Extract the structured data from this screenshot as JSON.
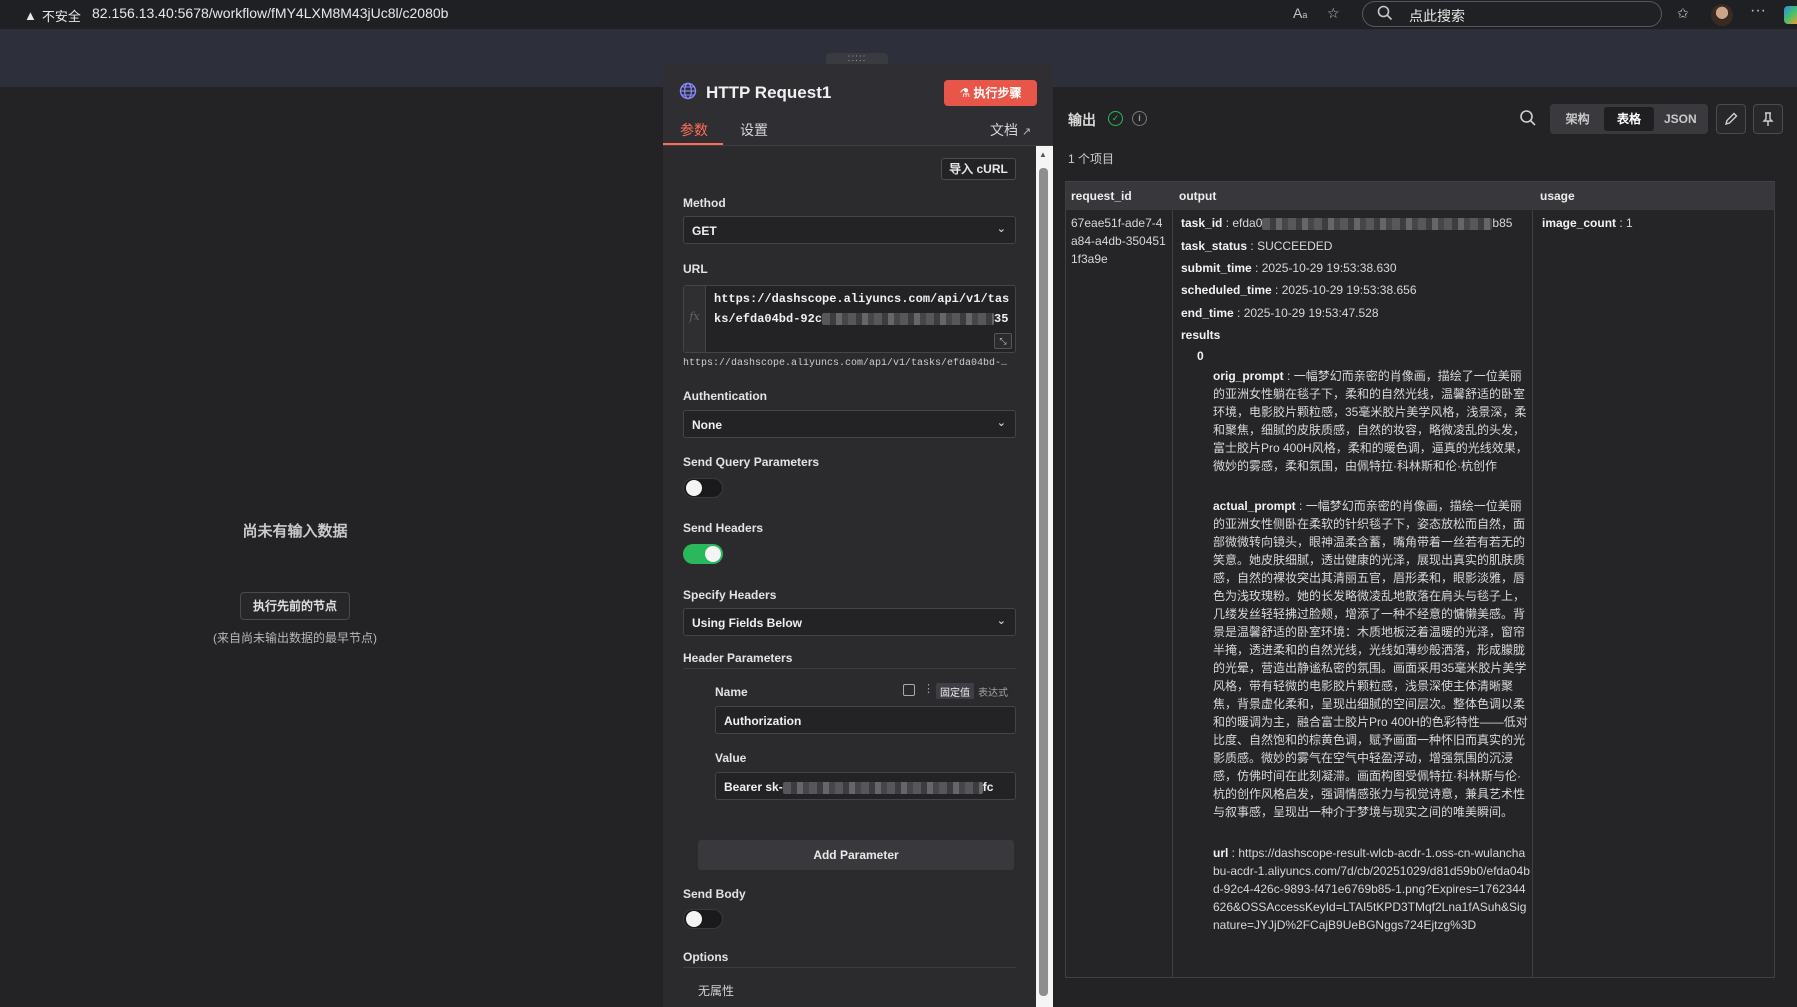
{
  "browser": {
    "security_label": "不安全",
    "url": "82.156.13.40:5678/workflow/fMY4LXM8M43jUc8l/c2080b",
    "search_placeholder": "点此搜索"
  },
  "input_panel": {
    "empty_title": "尚未有输入数据",
    "run_previous_label": "执行先前的节点",
    "run_previous_hint": "(来自尚未输出数据的最早节点)"
  },
  "node": {
    "drag_label": ":::::",
    "title": "HTTP Request1",
    "execute_step_label": "执行步骤",
    "tabs": [
      "参数",
      "设置"
    ],
    "docs_label": "文档",
    "import_curl_label": "导入 cURL",
    "method": {
      "label": "Method",
      "value": "GET"
    },
    "url": {
      "label": "URL",
      "value_line1": "https://dashscope.aliyuncs.com/api/v1/tas",
      "value_line2_start": "ks/efda04bd-92c",
      "value_line2_end": "35",
      "fx_label": "fx",
      "preview": "https://dashscope.aliyuncs.com/api/v1/tasks/efda04bd-…"
    },
    "authentication": {
      "label": "Authentication",
      "value": "None"
    },
    "send_query_parameters": {
      "label": "Send Query Parameters",
      "on": false
    },
    "send_headers": {
      "label": "Send Headers",
      "on": true
    },
    "specify_headers": {
      "label": "Specify Headers",
      "value": "Using Fields Below"
    },
    "header_parameters": {
      "label": "Header Parameters",
      "name_label": "Name",
      "fixed_label": "固定值",
      "expression_label": "表达式",
      "name_value": "Authorization",
      "value_label": "Value",
      "value_start": "Bearer sk-",
      "value_end": "fc"
    },
    "add_parameter_label": "Add Parameter",
    "send_body": {
      "label": "Send Body",
      "on": false
    },
    "options": {
      "label": "Options",
      "empty": "无属性"
    }
  },
  "output": {
    "title": "输出",
    "views": [
      "架构",
      "表格",
      "JSON"
    ],
    "active_view": "表格",
    "item_count": "1 个项目",
    "columns": [
      "request_id",
      "output",
      "usage"
    ],
    "request_id": "67eae51f-ade7-4a84-a4db-3504511f3a9e",
    "task_id_start": "efda0",
    "task_id_end": "b85",
    "task_status": "SUCCEEDED",
    "submit_time": "2025-10-29 19:53:38.630",
    "scheduled_time": "2025-10-29 19:53:38.656",
    "end_time": "2025-10-29 19:53:47.528",
    "results_label": "results",
    "result_index": "0",
    "orig_prompt": "一幅梦幻而亲密的肖像画，描绘了一位美丽的亚洲女性躺在毯子下，柔和的自然光线，温馨舒适的卧室环境，电影胶片颗粒感，35毫米胶片美学风格，浅景深，柔和聚焦，细腻的皮肤质感，自然的妆容，略微凌乱的头发，富士胶片Pro 400H风格，柔和的暖色调，逼真的光线效果，微妙的雾感，柔和氛围，由佩特拉·科林斯和伦·杭创作",
    "actual_prompt": "一幅梦幻而亲密的肖像画，描绘一位美丽的亚洲女性侧卧在柔软的针织毯子下，姿态放松而自然，面部微微转向镜头，眼神温柔含蓄，嘴角带着一丝若有若无的笑意。她皮肤细腻，透出健康的光泽，展现出真实的肌肤质感，自然的裸妆突出其清丽五官，眉形柔和，眼影淡雅，唇色为浅玫瑰粉。她的长发略微凌乱地散落在肩头与毯子上，几缕发丝轻轻拂过脸颊，增添了一种不经意的慵懒美感。背景是温馨舒适的卧室环境：木质地板泛着温暖的光泽，窗帘半掩，透进柔和的自然光线，光线如薄纱般洒落，形成朦胧的光晕，营造出静谧私密的氛围。画面采用35毫米胶片美学风格，带有轻微的电影胶片颗粒感，浅景深使主体清晰聚焦，背景虚化柔和，呈现出细腻的空间层次。整体色调以柔和的暖调为主，融合富士胶片Pro 400H的色彩特性——低对比度、自然饱和的棕黄色调，赋予画面一种怀旧而真实的光影质感。微妙的雾气在空气中轻盈浮动，增强氛围的沉浸感，仿佛时间在此刻凝滞。画面构图受佩特拉·科林斯与伦·杭的创作风格启发，强调情感张力与视觉诗意，兼具艺术性与叙事感，呈现出一种介于梦境与现实之间的唯美瞬间。",
    "url": "https://dashscope-result-wlcb-acdr-1.oss-cn-wulanchabu-acdr-1.aliyuncs.com/7d/cb/20251029/d81d59b0/efda04bd-92c4-426c-9893-f471e6769b85-1.png?Expires=1762344626&OSSAccessKeyId=LTAI5tKPD3TMqf2Lna1fASuh&Signature=JYJjD%2FCajB9UeBGNggs724Ejtzg%3D",
    "image_count": "1"
  }
}
